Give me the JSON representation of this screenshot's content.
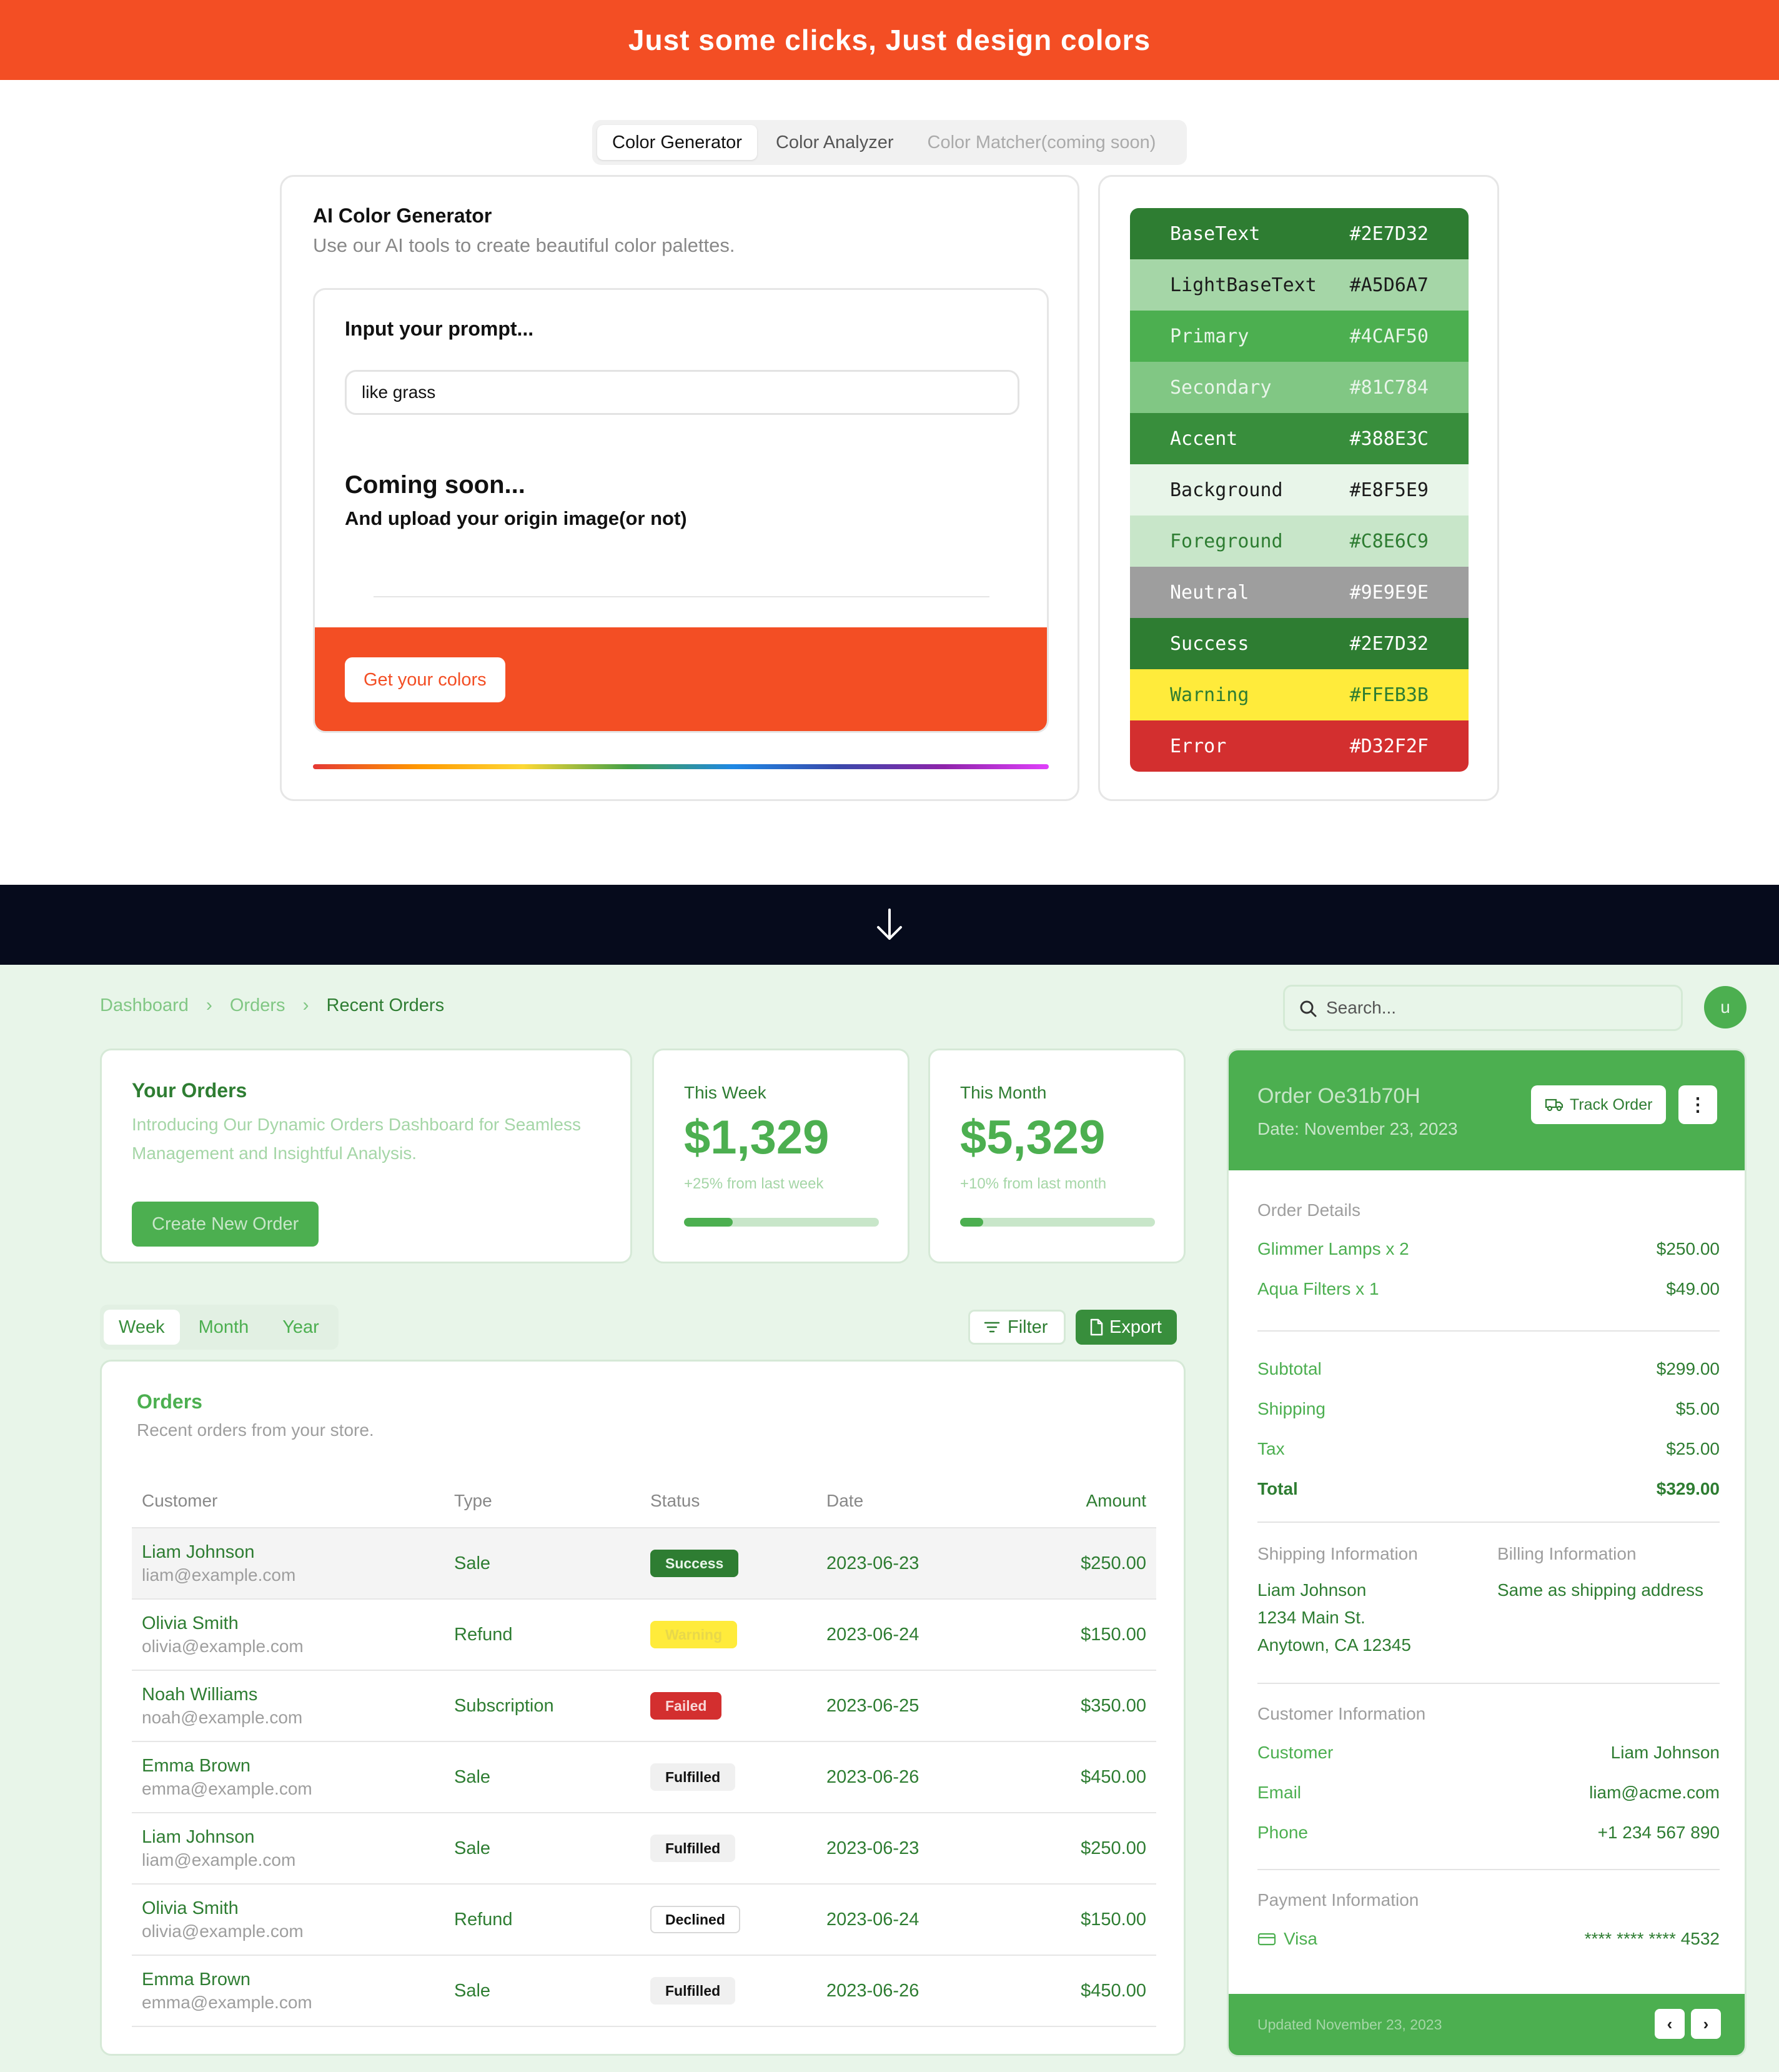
{
  "banner": {
    "title": "Just some clicks, Just design colors"
  },
  "tool_tabs": [
    {
      "label": "Color Generator"
    },
    {
      "label": "Color Analyzer"
    },
    {
      "label": "Color Matcher(coming soon)"
    }
  ],
  "generator": {
    "title": "AI Color Generator",
    "subtitle": "Use our AI tools to create beautiful color palettes.",
    "prompt_label": "Input your prompt...",
    "prompt_value": "like grass",
    "coming_title": "Coming soon...",
    "coming_sub": "And upload your origin image(or not)",
    "button": "Get your colors"
  },
  "palette": [
    {
      "name": "BaseText",
      "hex": "#2E7D32",
      "text_color": "#ffffff"
    },
    {
      "name": "LightBaseText",
      "hex": "#A5D6A7",
      "text_color": "#1b1b1b"
    },
    {
      "name": "Primary",
      "hex": "#4CAF50",
      "text_color": "#E8F5E9"
    },
    {
      "name": "Secondary",
      "hex": "#81C784",
      "text_color": "#E8F5E9"
    },
    {
      "name": "Accent",
      "hex": "#388E3C",
      "text_color": "#ffffff"
    },
    {
      "name": "Background",
      "hex": "#E8F5E9",
      "text_color": "#1b1b1b"
    },
    {
      "name": "Foreground",
      "hex": "#C8E6C9",
      "text_color": "#2E7D32"
    },
    {
      "name": "Neutral",
      "hex": "#9E9E9E",
      "text_color": "#ffffff"
    },
    {
      "name": "Success",
      "hex": "#2E7D32",
      "text_color": "#ffffff"
    },
    {
      "name": "Warning",
      "hex": "#FFEB3B",
      "text_color": "#2E7D32"
    },
    {
      "name": "Error",
      "hex": "#D32F2F",
      "text_color": "#ffffff"
    }
  ],
  "dashboard": {
    "breadcrumb": [
      "Dashboard",
      "Orders",
      "Recent Orders"
    ],
    "search_placeholder": "Search...",
    "avatar_initial": "u",
    "intro": {
      "title": "Your Orders",
      "description": "Introducing Our Dynamic Orders Dashboard for Seamless Management and Insightful Analysis.",
      "button": "Create New Order"
    },
    "stats": [
      {
        "label": "This Week",
        "value": "$1,329",
        "change": "+25% from last week",
        "progress": 0.25
      },
      {
        "label": "This Month",
        "value": "$5,329",
        "change": "+10% from last month",
        "progress": 0.12
      }
    ],
    "range_tabs": [
      "Week",
      "Month",
      "Year"
    ],
    "filter_label": "Filter",
    "export_label": "Export",
    "orders": {
      "title": "Orders",
      "subtitle": "Recent orders from your store.",
      "columns": [
        "Customer",
        "Type",
        "Status",
        "Date",
        "Amount"
      ],
      "rows": [
        {
          "name": "Liam Johnson",
          "email": "liam@example.com",
          "type": "Sale",
          "status": "Success",
          "date": "2023-06-23",
          "amount": "$250.00"
        },
        {
          "name": "Olivia Smith",
          "email": "olivia@example.com",
          "type": "Refund",
          "status": "Warning",
          "date": "2023-06-24",
          "amount": "$150.00"
        },
        {
          "name": "Noah Williams",
          "email": "noah@example.com",
          "type": "Subscription",
          "status": "Failed",
          "date": "2023-06-25",
          "amount": "$350.00"
        },
        {
          "name": "Emma Brown",
          "email": "emma@example.com",
          "type": "Sale",
          "status": "Fulfilled",
          "date": "2023-06-26",
          "amount": "$450.00"
        },
        {
          "name": "Liam Johnson",
          "email": "liam@example.com",
          "type": "Sale",
          "status": "Fulfilled",
          "date": "2023-06-23",
          "amount": "$250.00"
        },
        {
          "name": "Olivia Smith",
          "email": "olivia@example.com",
          "type": "Refund",
          "status": "Declined",
          "date": "2023-06-24",
          "amount": "$150.00"
        },
        {
          "name": "Emma Brown",
          "email": "emma@example.com",
          "type": "Sale",
          "status": "Fulfilled",
          "date": "2023-06-26",
          "amount": "$450.00"
        }
      ]
    },
    "status_styles": {
      "Success": {
        "bg": "#2E7D32",
        "fg": "#E8F5E9",
        "border": "#2E7D32"
      },
      "Warning": {
        "bg": "#FFEB3B",
        "fg": "#E8D84A",
        "border": "#FFEB3B"
      },
      "Failed": {
        "bg": "#D32F2F",
        "fg": "#F8D7D7",
        "border": "#D32F2F"
      },
      "Fulfilled": {
        "bg": "#f0f0f0",
        "fg": "#111111",
        "border": "#f0f0f0"
      },
      "Declined": {
        "bg": "#ffffff",
        "fg": "#111111",
        "border": "#d8d8d8"
      }
    },
    "order_detail": {
      "id": "Order Oe31b70H",
      "date": "Date: November 23, 2023",
      "track_label": "Track Order",
      "details_title": "Order Details",
      "items": [
        {
          "label": "Glimmer Lamps x 2",
          "value": "$250.00"
        },
        {
          "label": "Aqua Filters x 1",
          "value": "$49.00"
        }
      ],
      "summary": [
        {
          "label": "Subtotal",
          "value": "$299.00"
        },
        {
          "label": "Shipping",
          "value": "$5.00"
        },
        {
          "label": "Tax",
          "value": "$25.00"
        },
        {
          "label": "Total",
          "value": "$329.00"
        }
      ],
      "shipping_title": "Shipping Information",
      "shipping_lines": [
        "Liam Johnson",
        "1234 Main St.",
        "Anytown, CA 12345"
      ],
      "billing_title": "Billing Information",
      "billing_text": "Same as shipping address",
      "customer_title": "Customer Information",
      "customer": [
        {
          "label": "Customer",
          "value": "Liam Johnson"
        },
        {
          "label": "Email",
          "value": "liam@acme.com"
        },
        {
          "label": "Phone",
          "value": "+1 234 567 890"
        }
      ],
      "payment_title": "Payment Information",
      "payment_method": "Visa",
      "card_number": "**** **** **** 4532",
      "updated": "Updated November 23, 2023"
    }
  }
}
